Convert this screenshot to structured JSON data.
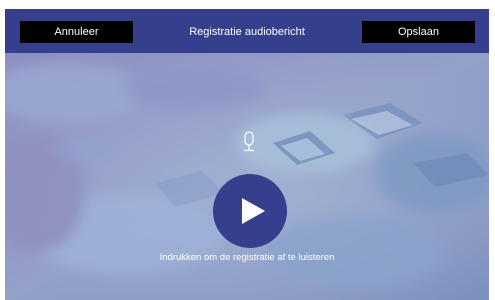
{
  "header": {
    "cancel_label": "Annuleer",
    "title": "Registratie audiobericht",
    "save_label": "Opslaan"
  },
  "player": {
    "mic_icon": "microphone-icon",
    "play_icon": "play-icon",
    "hint": "Indrukken om de registratie af te luisteren"
  },
  "colors": {
    "header_bg": "#353f8e",
    "button_bg": "#000000",
    "play_bg": "#353f8e"
  }
}
